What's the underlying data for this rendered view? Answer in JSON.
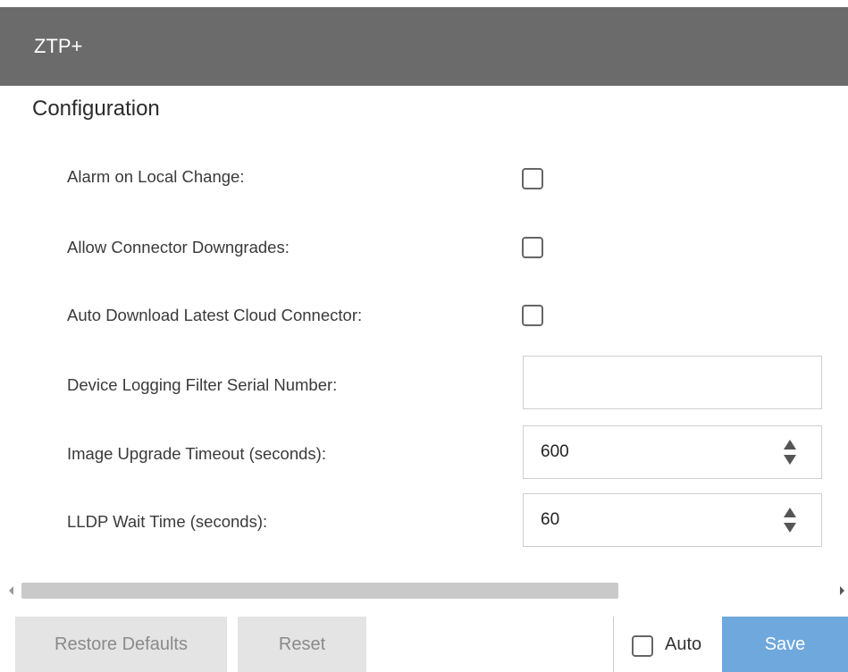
{
  "panel": {
    "title": "ZTP+"
  },
  "section": {
    "title": "Configuration"
  },
  "rows": [
    {
      "label": "Alarm on Local Change:",
      "control": "checkbox",
      "checked": false
    },
    {
      "label": "Allow Connector Downgrades:",
      "control": "checkbox",
      "checked": false
    },
    {
      "label": "Auto Download Latest Cloud Connector:",
      "control": "checkbox",
      "checked": false
    },
    {
      "label": "Device Logging Filter Serial Number:",
      "control": "text",
      "value": ""
    },
    {
      "label": "Image Upgrade Timeout (seconds):",
      "control": "number",
      "value": "600"
    },
    {
      "label": "LLDP Wait Time (seconds):",
      "control": "number",
      "value": "60"
    }
  ],
  "footer": {
    "restore_label": "Restore Defaults",
    "reset_label": "Reset",
    "auto_label": "Auto",
    "auto_checked": false,
    "save_label": "Save"
  },
  "colors": {
    "titlebar": "#6b6b6b",
    "save_button": "#6fa8dc",
    "disabled_button": "#e4e4e4"
  }
}
